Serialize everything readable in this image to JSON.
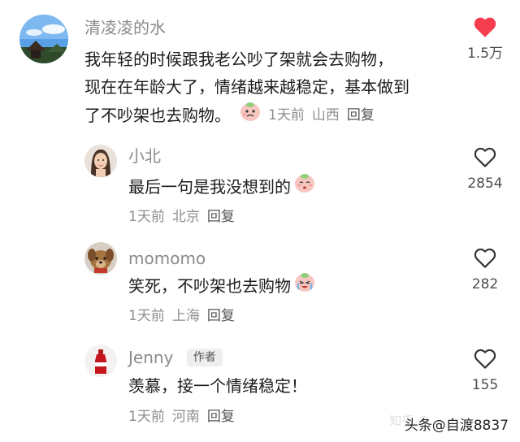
{
  "comments": [
    {
      "username": "清凌凌的水",
      "text_lines": [
        "我年轻的时候跟我老公吵了架就会去购物，",
        "现在在年龄大了，情绪越来越稳定，基本做到",
        "了不吵架也去购物。"
      ],
      "time": "1天前",
      "location": "山西",
      "reply_label": "回复",
      "likes": "1.5万",
      "liked": true,
      "avatar": "landscape-avatar"
    },
    {
      "username": "小北",
      "text": "最后一句是我没想到的",
      "time": "1天前",
      "location": "北京",
      "reply_label": "回复",
      "likes": "2854",
      "liked": false,
      "avatar": "woman-portrait-avatar"
    },
    {
      "username": "momomo",
      "text": "笑死，不吵架也去购物",
      "time": "1天前",
      "location": "上海",
      "reply_label": "回复",
      "likes": "282",
      "liked": false,
      "avatar": "dog-avatar"
    },
    {
      "username": "Jenny",
      "author_tag": "作者",
      "text": "羡慕，接一个情绪稳定！",
      "time": "1天前",
      "location": "河南",
      "reply_label": "回复",
      "likes": "155",
      "liked": false,
      "avatar": "cola-bottle-avatar"
    }
  ],
  "colors": {
    "liked_heart": "#f53d4d",
    "outline_heart": "#333333",
    "meta_gray": "#8e8e8e"
  },
  "watermark": "头条@自渡8837",
  "watermark_faint": "知乎 @…"
}
